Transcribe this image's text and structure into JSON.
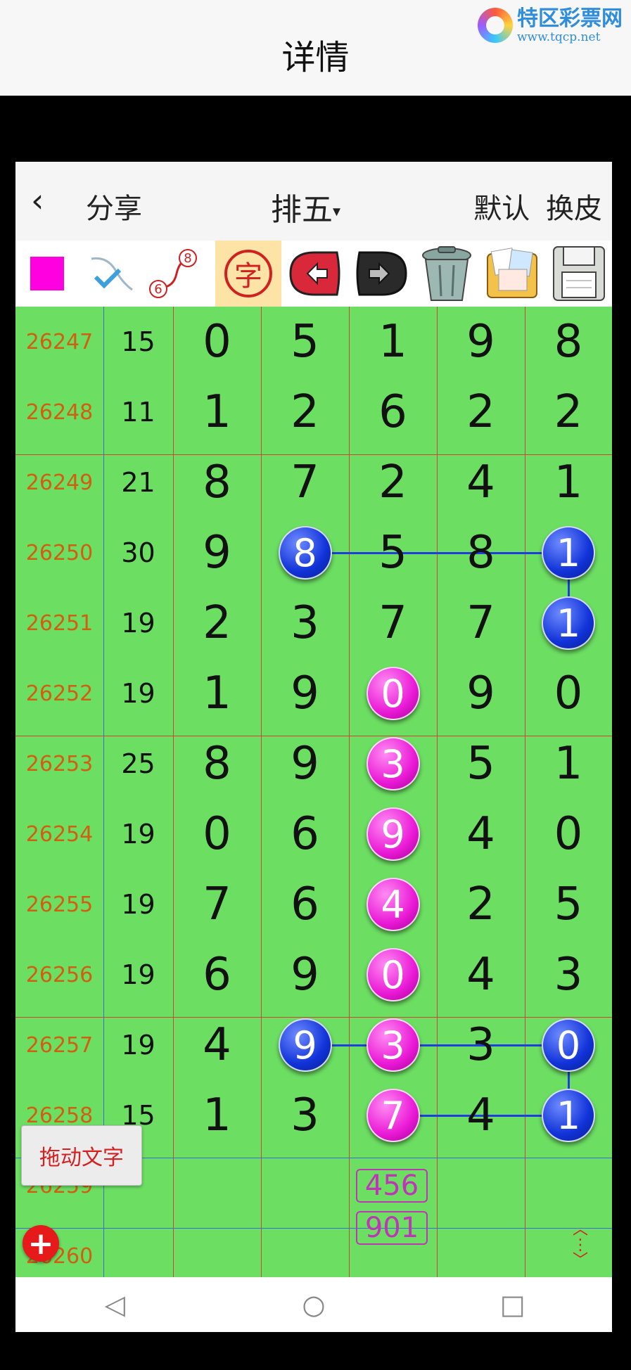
{
  "topbar": {
    "title": "详情"
  },
  "brand": {
    "name": "特区彩票网",
    "url": "www.tqcp.net"
  },
  "header": {
    "back_icon": "chevron-left-icon",
    "share": "分享",
    "lottery": "排五",
    "caret": "▾",
    "default_label": "默认",
    "skin_label": "换皮"
  },
  "toolbar": {
    "char_label": "字",
    "ball_numbers": [
      "8",
      "6"
    ],
    "icons": [
      "magenta-square-icon",
      "brush-icon",
      "number-curve-icon",
      "character-icon",
      "undo-icon",
      "redo-icon",
      "trash-icon",
      "gallery-icon",
      "save-icon"
    ]
  },
  "colors": {
    "grid_bg": "#6cde62",
    "blue_ball": "#1032d8",
    "magenta_ball": "#ea19d6",
    "issue_text": "#d06010",
    "accent_red": "#d42020"
  },
  "rows": [
    {
      "issue": "26247",
      "sum": "15",
      "digits": [
        "0",
        "5",
        "1",
        "9",
        "8"
      ],
      "marks": [
        "",
        "",
        "",
        "",
        ""
      ]
    },
    {
      "issue": "26248",
      "sum": "11",
      "digits": [
        "1",
        "2",
        "6",
        "2",
        "2"
      ],
      "marks": [
        "",
        "",
        "",
        "",
        ""
      ]
    },
    {
      "issue": "26249",
      "sum": "21",
      "digits": [
        "8",
        "7",
        "2",
        "4",
        "1"
      ],
      "marks": [
        "",
        "",
        "",
        "",
        ""
      ]
    },
    {
      "issue": "26250",
      "sum": "30",
      "digits": [
        "9",
        "8",
        "5",
        "8",
        "1"
      ],
      "marks": [
        "",
        "blue",
        "",
        "",
        "blue"
      ]
    },
    {
      "issue": "26251",
      "sum": "19",
      "digits": [
        "2",
        "3",
        "7",
        "7",
        "1"
      ],
      "marks": [
        "",
        "",
        "",
        "",
        "blue"
      ]
    },
    {
      "issue": "26252",
      "sum": "19",
      "digits": [
        "1",
        "9",
        "0",
        "9",
        "0"
      ],
      "marks": [
        "",
        "",
        "mag",
        "",
        ""
      ]
    },
    {
      "issue": "26253",
      "sum": "25",
      "digits": [
        "8",
        "9",
        "3",
        "5",
        "1"
      ],
      "marks": [
        "",
        "",
        "mag",
        "",
        ""
      ]
    },
    {
      "issue": "26254",
      "sum": "19",
      "digits": [
        "0",
        "6",
        "9",
        "4",
        "0"
      ],
      "marks": [
        "",
        "",
        "mag",
        "",
        ""
      ]
    },
    {
      "issue": "26255",
      "sum": "19",
      "digits": [
        "7",
        "6",
        "4",
        "2",
        "5"
      ],
      "marks": [
        "",
        "",
        "mag",
        "",
        ""
      ]
    },
    {
      "issue": "26256",
      "sum": "19",
      "digits": [
        "6",
        "9",
        "0",
        "4",
        "3"
      ],
      "marks": [
        "",
        "",
        "mag",
        "",
        ""
      ]
    },
    {
      "issue": "26257",
      "sum": "19",
      "digits": [
        "4",
        "9",
        "3",
        "3",
        "0"
      ],
      "marks": [
        "",
        "blue",
        "mag",
        "",
        "blue"
      ]
    },
    {
      "issue": "26258",
      "sum": "15",
      "digits": [
        "1",
        "3",
        "7",
        "4",
        "1"
      ],
      "marks": [
        "",
        "",
        "mag",
        "",
        "blue"
      ]
    },
    {
      "issue": "26259",
      "sum": "",
      "digits": [
        "",
        "",
        "",
        "",
        ""
      ],
      "marks": [
        "",
        "",
        "",
        "",
        ""
      ]
    },
    {
      "issue": "26260",
      "sum": "",
      "digits": [
        "",
        "",
        "",
        "",
        ""
      ],
      "marks": [
        "",
        "",
        "",
        "",
        ""
      ]
    }
  ],
  "predictions": [
    "456",
    "901"
  ],
  "drag_text_button": "拖动文字",
  "plus_icon": "plus-circle-icon",
  "updown_icon": "up-down-arrows-icon",
  "navbar": {
    "back": "◁",
    "home": "○",
    "recent": "□"
  }
}
